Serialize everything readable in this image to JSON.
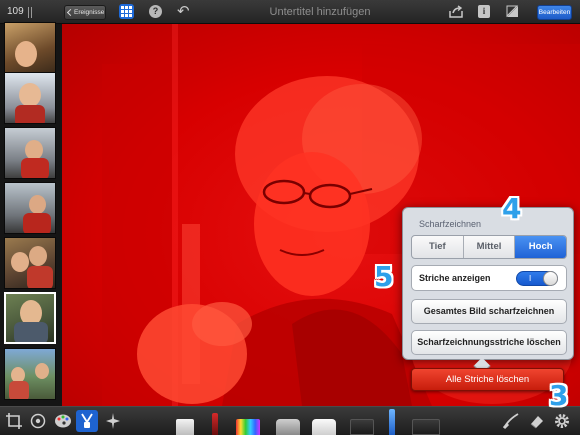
{
  "topbar": {
    "photo_count": "109",
    "back_label": "Ereignisse",
    "title_placeholder": "Untertitel hinzufügen",
    "edit_label": "Bearbeiten"
  },
  "popover": {
    "title": "Scharfzeichnen",
    "strength_options": [
      "Tief",
      "Mittel",
      "Hoch"
    ],
    "selected_strength": "Hoch",
    "show_strokes_label": "Striche anzeigen",
    "show_strokes_on": true,
    "toggle_on_text": "I",
    "sharpen_all_label": "Gesamtes Bild scharfzeichnen",
    "clear_sharpen_label": "Scharfzeichnungsstriche löschen"
  },
  "delete_all_label": "Alle Striche löschen",
  "annotations": [
    "4",
    "5",
    "3"
  ],
  "colors": {
    "accent": "#1e63d0",
    "overlay_red": "#d70000",
    "delete_red": "#d9301c",
    "annotation_blue": "#2ea0ea"
  },
  "icons": {
    "top": [
      "grid-icon",
      "help-icon",
      "undo-icon",
      "share-icon",
      "info-icon",
      "compare-icon"
    ],
    "bottom_left": [
      "crop-icon",
      "rotate-icon",
      "palette-icon",
      "brush-icon",
      "effects-icon"
    ],
    "bottom_right": [
      "brush-stroke-icon",
      "eraser-icon",
      "gear-icon"
    ]
  }
}
